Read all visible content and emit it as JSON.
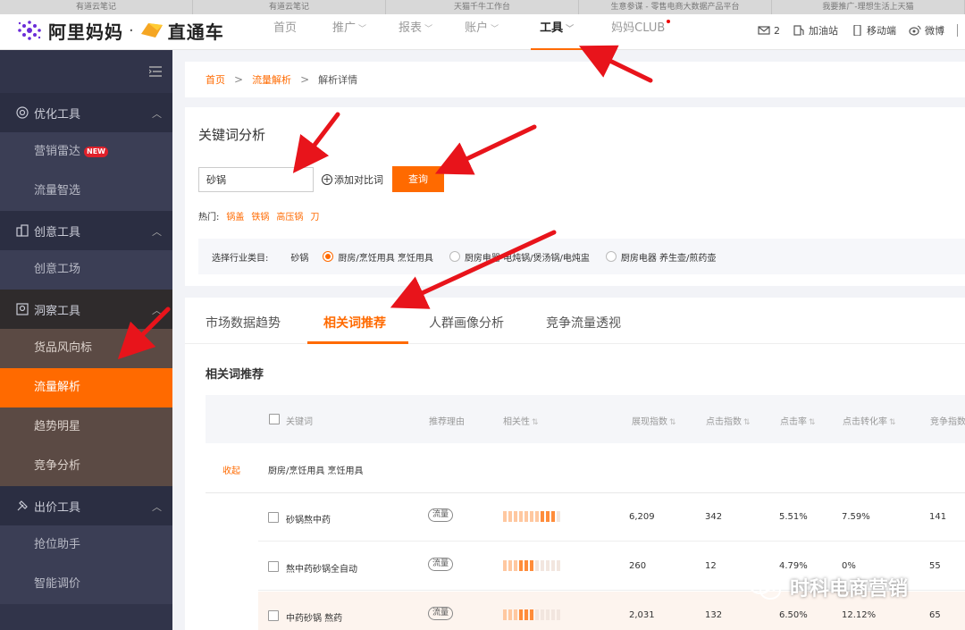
{
  "browser_tabs": [
    "有道云笔记",
    "有道云笔记",
    "天猫千牛工作台",
    "生意参谋 - 零售电商大数据产品平台",
    "我要推广-理想生活上天猫"
  ],
  "logo": {
    "brand1": "阿里妈妈",
    "sep": "·",
    "brand2": "直通车"
  },
  "nav": {
    "items": [
      {
        "label": "首页",
        "chevron": false
      },
      {
        "label": "推广",
        "chevron": true
      },
      {
        "label": "报表",
        "chevron": true
      },
      {
        "label": "账户",
        "chevron": true
      },
      {
        "label": "工具",
        "chevron": true,
        "active": true
      },
      {
        "label": "妈妈CLUB",
        "chevron": false,
        "dot": true
      }
    ],
    "right": {
      "mail_count": "2",
      "refuel": "加油站",
      "mobile": "移动端",
      "weibo": "微博"
    }
  },
  "sidebar": {
    "groups": [
      {
        "label": "优化工具",
        "icon": "target-icon",
        "items": [
          {
            "label": "营销雷达",
            "badge": "NEW"
          },
          {
            "label": "流量智选"
          }
        ]
      },
      {
        "label": "创意工具",
        "icon": "building-icon",
        "items": [
          {
            "label": "创意工场"
          }
        ]
      },
      {
        "label": "洞察工具",
        "icon": "insight-icon",
        "items": [
          {
            "label": "货品风向标"
          },
          {
            "label": "流量解析",
            "active": true
          },
          {
            "label": "趋势明星"
          },
          {
            "label": "竞争分析"
          }
        ]
      },
      {
        "label": "出价工具",
        "icon": "bid-icon",
        "items": [
          {
            "label": "抢位助手"
          },
          {
            "label": "智能调价"
          }
        ]
      }
    ]
  },
  "breadcrumb": {
    "home": "首页",
    "section": "流量解析",
    "current": "解析详情"
  },
  "keyword_card": {
    "title": "关键词分析",
    "search_value": "砂锅",
    "add_compare": "添加对比词",
    "query_button": "查询",
    "hot_label": "热门:",
    "hot_words": [
      "锅盖",
      "铁锅",
      "高压锅",
      "刀"
    ],
    "category_label": "选择行业类目:",
    "category_keyword": "砂锅",
    "category_options": [
      {
        "label": "厨房/烹饪用具 烹饪用具",
        "selected": true
      },
      {
        "label": "厨房电器 电炖锅/煲汤锅/电炖盅",
        "selected": false
      },
      {
        "label": "厨房电器 养生壶/煎药壶",
        "selected": false
      }
    ]
  },
  "analysis": {
    "tabs": [
      "市场数据趋势",
      "相关词推荐",
      "人群画像分析",
      "竞争流量透视"
    ],
    "active_tab": 1,
    "section_title": "相关词推荐",
    "columns": [
      "关键词",
      "推荐理由",
      "相关性",
      "展现指数",
      "点击指数",
      "点击率",
      "点击转化率",
      "竞争指数"
    ],
    "collapse_label": "收起",
    "group_label": "厨房/烹饪用具 烹饪用具",
    "rows": [
      {
        "keyword": "砂锅熬中药",
        "reason": "流量",
        "relevance": 10,
        "impressions": "6,209",
        "clicks": "342",
        "ctr": "5.51%",
        "cvr": "7.59%",
        "competition": "141"
      },
      {
        "keyword": "熬中药砂锅全自动",
        "reason": "流量",
        "relevance": 6,
        "impressions": "260",
        "clicks": "12",
        "ctr": "4.79%",
        "cvr": "0%",
        "competition": "55"
      },
      {
        "keyword": "中药砂锅 熬药",
        "reason": "流量",
        "relevance": 6,
        "impressions": "2,031",
        "clicks": "132",
        "ctr": "6.50%",
        "cvr": "12.12%",
        "competition": "65"
      }
    ]
  },
  "watermark": {
    "text": "时科电商营销"
  },
  "colors": {
    "accent": "#ff6a00",
    "sidebar": "#31344a",
    "arrow": "#e8141b"
  }
}
